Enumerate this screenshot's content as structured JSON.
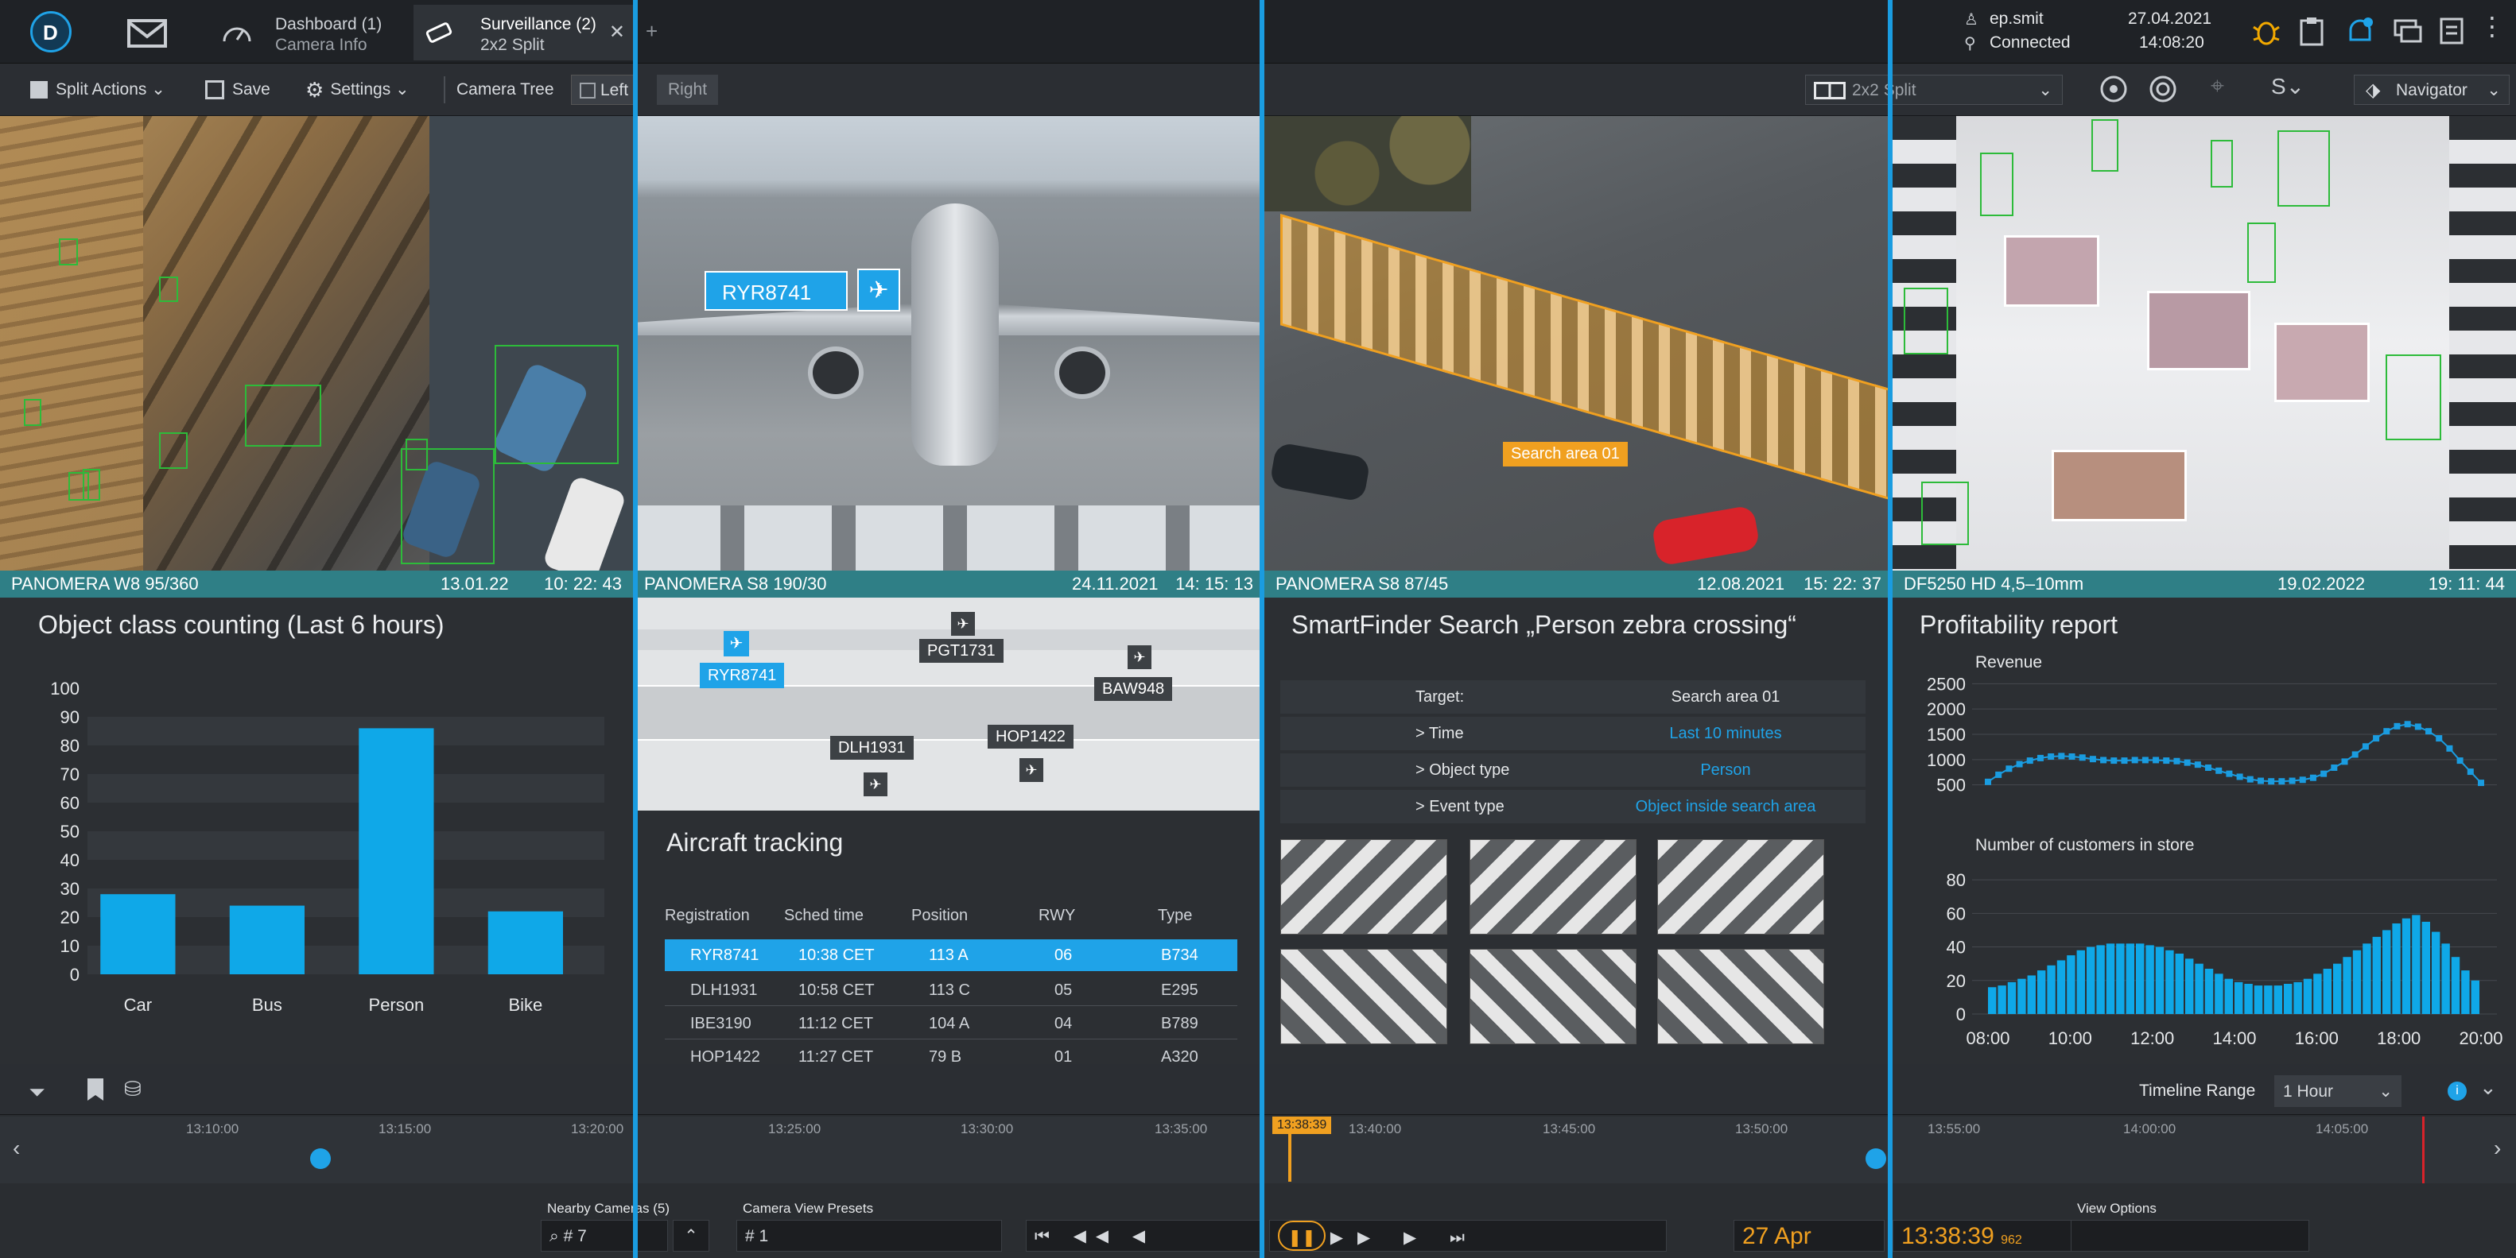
{
  "topbar": {
    "tabs": [
      {
        "title": "Dashboard (1)",
        "subtitle": "Camera Info"
      },
      {
        "title": "Surveillance (2)",
        "subtitle": "2x2 Split"
      }
    ],
    "user": "ep.smit",
    "status": "Connected",
    "date": "27.04.2021",
    "time": "14:08:20",
    "new_tab_symbol": "+"
  },
  "toolbar": {
    "split_actions": "Split Actions",
    "save": "Save",
    "settings": "Settings",
    "camera_tree": "Camera Tree",
    "left": "Left",
    "right": "Right",
    "layout": "2x2 Split",
    "navigator": "Navigator"
  },
  "panes": {
    "p1": {
      "camera": "PANOMERA W8 95/360",
      "date": "13.01.22",
      "time": "10: 22: 43",
      "title": "Object class counting (Last 6 hours)"
    },
    "p2": {
      "camera": "PANOMERA S8 190/30",
      "date": "24.11.2021",
      "time": "14: 15: 13",
      "callout": "RYR8741",
      "map_labels": [
        "RYR8741",
        "PGT1731",
        "BAW948",
        "DLH1931",
        "HOP1422"
      ],
      "title": "Aircraft tracking",
      "headers": [
        "Registration",
        "Sched time",
        "Position",
        "RWY",
        "Type"
      ],
      "rows": [
        [
          "RYR8741",
          "10:38 CET",
          "113 A",
          "06",
          "B734"
        ],
        [
          "DLH1931",
          "10:58 CET",
          "113 C",
          "05",
          "E295"
        ],
        [
          "IBE3190",
          "11:12 CET",
          "104 A",
          "04",
          "B789"
        ],
        [
          "HOP1422",
          "11:27 CET",
          "79 B",
          "01",
          "A320"
        ]
      ]
    },
    "p3": {
      "camera": "PANOMERA S8 87/45",
      "date": "12.08.2021",
      "time": "15: 22: 37",
      "search_area_label": "Search area 01",
      "title": "SmartFinder Search „Person zebra crossing“",
      "fields": [
        {
          "key": "Target:",
          "value": "Search area 01"
        },
        {
          "key": "> Time",
          "value": "Last 10 minutes"
        },
        {
          "key": "> Object type",
          "value": "Person"
        },
        {
          "key": "> Event type",
          "value": "Object inside search area"
        }
      ]
    },
    "p4": {
      "camera": "DF5250 HD 4,5–10mm",
      "date": "19.02.2022",
      "time": "19: 11: 44",
      "title": "Profitability report",
      "revenue_label": "Revenue",
      "customers_label": "Number of customers in store"
    }
  },
  "chart_data": [
    {
      "type": "bar",
      "title": "Object class counting (Last 6 hours)",
      "categories": [
        "Car",
        "Bus",
        "Person",
        "Bike"
      ],
      "values": [
        28,
        24,
        86,
        22
      ],
      "ylim": [
        0,
        100
      ],
      "yticks": [
        0,
        10,
        20,
        30,
        40,
        50,
        60,
        70,
        80,
        90,
        100
      ],
      "grid": true,
      "color": "#0fa8e8"
    },
    {
      "type": "line",
      "title": "Revenue",
      "yticks": [
        500,
        1000,
        1500,
        2000,
        2500
      ],
      "ylim": [
        400,
        2600
      ],
      "x": [
        "08:00",
        "08:15",
        "08:30",
        "08:45",
        "09:00",
        "09:15",
        "09:30",
        "09:45",
        "10:00",
        "10:15",
        "10:30",
        "10:45",
        "11:00",
        "11:15",
        "11:30",
        "11:45",
        "12:00",
        "12:15",
        "12:30",
        "12:45",
        "13:00",
        "13:15",
        "13:30",
        "13:45",
        "14:00",
        "14:15",
        "14:30",
        "14:45",
        "15:00",
        "15:15",
        "15:30",
        "15:45",
        "16:00",
        "16:15",
        "16:30",
        "16:45",
        "17:00",
        "17:15",
        "17:30",
        "17:45",
        "18:00",
        "18:15",
        "18:30",
        "18:45",
        "19:00",
        "19:15",
        "19:30",
        "19:45"
      ],
      "values": [
        560,
        700,
        820,
        910,
        980,
        1030,
        1060,
        1070,
        1060,
        1040,
        1010,
        990,
        980,
        980,
        990,
        990,
        990,
        980,
        970,
        940,
        900,
        840,
        780,
        720,
        660,
        610,
        580,
        570,
        570,
        580,
        600,
        640,
        720,
        840,
        960,
        1100,
        1260,
        1420,
        1560,
        1660,
        1700,
        1650,
        1560,
        1420,
        1220,
        980,
        760,
        540
      ],
      "color": "#1a9ce0"
    },
    {
      "type": "bar",
      "title": "Number of customers in store",
      "yticks": [
        0,
        20,
        40,
        60,
        80
      ],
      "ylim": [
        0,
        90
      ],
      "xticks": [
        "08:00",
        "10:00",
        "12:00",
        "14:00",
        "16:00",
        "18:00",
        "20:00"
      ],
      "values": [
        16,
        17,
        19,
        21,
        23,
        26,
        29,
        32,
        35,
        38,
        40,
        41,
        42,
        42,
        42,
        42,
        41,
        40,
        38,
        36,
        33,
        30,
        27,
        24,
        21,
        19,
        18,
        17,
        17,
        17,
        18,
        19,
        21,
        24,
        27,
        30,
        34,
        38,
        42,
        46,
        50,
        54,
        57,
        59,
        55,
        49,
        42,
        34,
        26,
        20
      ],
      "color": "#0fa8e8"
    }
  ],
  "timeline": {
    "range_label": "Timeline Range",
    "range_value": "1 Hour",
    "ticks": [
      "13:10:00",
      "13:15:00",
      "13:20:00",
      "13:25:00",
      "13:30:00",
      "13:35:00",
      "13:40:00",
      "13:45:00",
      "13:50:00",
      "13:55:00",
      "14:00:00",
      "14:05:00"
    ],
    "marker_time": "13:38:39",
    "nearby_label": "Nearby Cameras (5)",
    "nearby_item": "# 7",
    "presets_label": "Camera View Presets",
    "preset_item": "# 1",
    "date": "27 Apr",
    "clock": "13:38:39",
    "clock_ms": "962",
    "view_options": "View Options"
  }
}
